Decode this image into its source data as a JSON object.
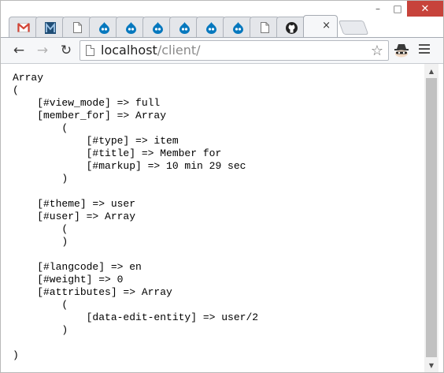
{
  "window": {
    "minimize_glyph": "–",
    "maximize_glyph": "□",
    "close_glyph": "✕"
  },
  "tabs": [
    {
      "icon": "gmail-icon",
      "color": "#d44638"
    },
    {
      "icon": "m-logo-icon",
      "color": "#2b5d8a"
    },
    {
      "icon": "page-icon",
      "color": "#8a8a8a"
    },
    {
      "icon": "drupal-icon",
      "color": "#0678be"
    },
    {
      "icon": "drupal-icon",
      "color": "#0678be"
    },
    {
      "icon": "drupal-icon",
      "color": "#0678be"
    },
    {
      "icon": "drupal-icon",
      "color": "#0678be"
    },
    {
      "icon": "drupal-icon",
      "color": "#0678be"
    },
    {
      "icon": "drupal-icon",
      "color": "#0678be"
    },
    {
      "icon": "page-icon",
      "color": "#8a8a8a"
    },
    {
      "icon": "github-icon",
      "color": "#222222"
    },
    {
      "icon": "active-tab",
      "close_glyph": "×"
    }
  ],
  "toolbar": {
    "back_glyph": "←",
    "forward_glyph": "→",
    "reload_glyph": "↻",
    "star_glyph": "☆",
    "url_host": "localhost",
    "url_path": "/client/"
  },
  "content": {
    "lines": [
      "Array",
      "(",
      "    [#view_mode] => full",
      "    [member_for] => Array",
      "        (",
      "            [#type] => item",
      "            [#title] => Member for",
      "            [#markup] => 10 min 29 sec",
      "        )",
      "",
      "    [#theme] => user",
      "    [#user] => Array",
      "        (",
      "        )",
      "",
      "    [#langcode] => en",
      "    [#weight] => 0",
      "    [#attributes] => Array",
      "        (",
      "            [data-edit-entity] => user/2",
      "        )",
      "",
      ")"
    ]
  },
  "scrollbar": {
    "up_glyph": "▲",
    "down_glyph": "▼"
  }
}
